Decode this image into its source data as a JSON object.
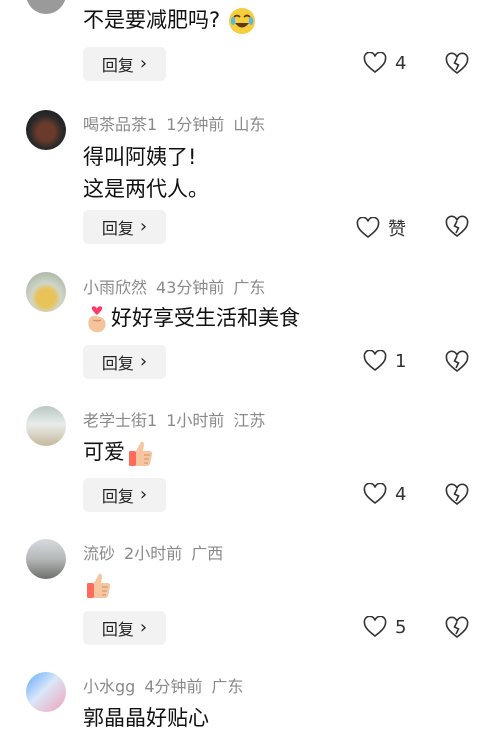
{
  "comments": [
    {
      "text_lines": [
        "不是要减肥吗?"
      ],
      "reply_label": "回复",
      "like_count": "4"
    },
    {
      "username": "喝茶品茶1",
      "time": "1分钟前",
      "location": "山东",
      "text_lines": [
        "得叫阿姨了!",
        "这是两代人。"
      ],
      "reply_label": "回复",
      "like_count": "赞"
    },
    {
      "username": "小雨欣然",
      "time": "43分钟前",
      "location": "广东",
      "text_lines": [
        "好好享受生活和美食"
      ],
      "reply_label": "回复",
      "like_count": "1"
    },
    {
      "username": "老学士街1",
      "time": "1小时前",
      "location": "江苏",
      "text_lines": [
        "可爱"
      ],
      "reply_label": "回复",
      "like_count": "4"
    },
    {
      "username": "流砂",
      "time": "2小时前",
      "location": "广西",
      "text_lines": [
        ""
      ],
      "reply_label": "回复",
      "like_count": "5"
    },
    {
      "username": "小水gg",
      "time": "4分钟前",
      "location": "广东",
      "text_lines": [
        "郭晶晶好贴心"
      ]
    }
  ],
  "icons": {
    "like": "heart-outline-icon",
    "dislike": "broken-heart-icon",
    "chevron": "chevron-right-icon"
  }
}
